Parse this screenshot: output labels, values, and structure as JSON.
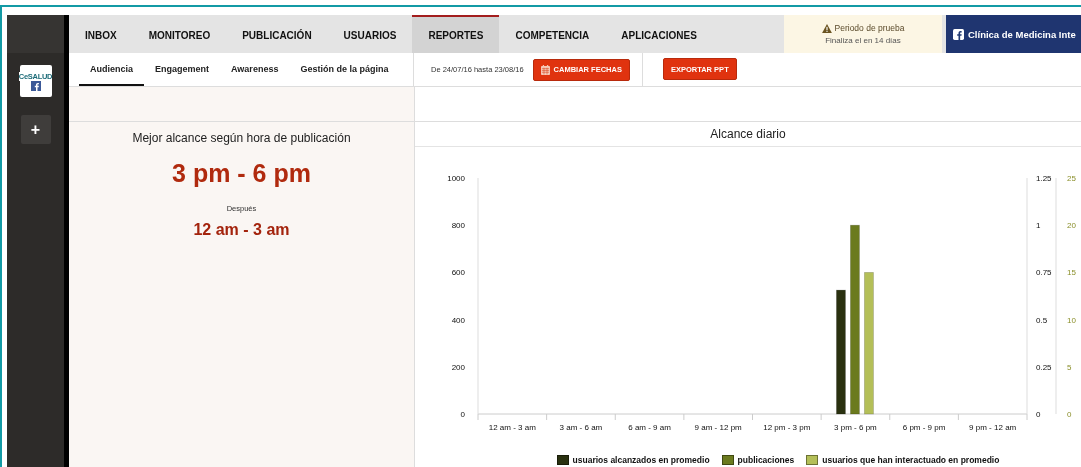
{
  "sidebar": {
    "logo_text": "CeSALUD",
    "add_symbol": "+"
  },
  "nav": {
    "tabs": [
      {
        "label": "INBOX",
        "selected": false
      },
      {
        "label": "MONITOREO",
        "selected": false
      },
      {
        "label": "PUBLICACIÓN",
        "selected": false
      },
      {
        "label": "USUARIOS",
        "selected": false
      },
      {
        "label": "REPORTES",
        "selected": true
      },
      {
        "label": "COMPETENCIA",
        "selected": false
      },
      {
        "label": "APLICACIONES",
        "selected": false
      }
    ],
    "trial": {
      "title": "Periodo de prueba",
      "subtitle": "Finaliza el en 14 días"
    },
    "account": "Clínica de Medicina Inte"
  },
  "subnav": {
    "tabs": [
      {
        "label": "Audiencia",
        "selected": true
      },
      {
        "label": "Engagement",
        "selected": false
      },
      {
        "label": "Awareness",
        "selected": false
      },
      {
        "label": "Gestión de la página",
        "selected": false
      }
    ],
    "date_range": "De 24/07/16 hasta 23/08/16",
    "change_dates": "CAMBIAR FECHAS",
    "export": "EXPORTAR PPT"
  },
  "best_time": {
    "title": "Mejor alcance según hora de publicación",
    "best": "3 pm - 6 pm",
    "after_label": "Después",
    "second": "12 am - 3 am"
  },
  "daily_reach": {
    "title": "Alcance diario",
    "chart_data": {
      "type": "bar",
      "categories": [
        "12 am - 3 am",
        "3 am - 6 am",
        "6 am - 9 am",
        "9 am - 12 pm",
        "12 pm - 3 pm",
        "3 pm - 6 pm",
        "6 pm - 9 pm",
        "9 pm - 12 am"
      ],
      "series": [
        {
          "name": "usuarios alcanzados en promedio",
          "color": "#2a3110",
          "axis": "y",
          "values": [
            0,
            0,
            0,
            0,
            0,
            525,
            0,
            0
          ]
        },
        {
          "name": "publicaciones",
          "color": "#6b7a1e",
          "axis": "y2",
          "values": [
            0,
            0,
            0,
            0,
            0,
            1,
            0,
            0
          ]
        },
        {
          "name": "usuarios que han interactuado en promedio",
          "color": "#b4bf58",
          "axis": "y3",
          "values": [
            0,
            0,
            0,
            0,
            0,
            15,
            0,
            0
          ]
        }
      ],
      "ylim": [
        0,
        1000
      ],
      "yticks": [
        0,
        200,
        400,
        600,
        800,
        1000
      ],
      "y2lim": [
        0,
        1.25
      ],
      "y2ticks": [
        0,
        0.25,
        0.5,
        0.75,
        1,
        1.25
      ],
      "y3lim": [
        0,
        25
      ],
      "y3ticks": [
        0,
        5,
        10,
        15,
        20,
        25
      ]
    }
  }
}
